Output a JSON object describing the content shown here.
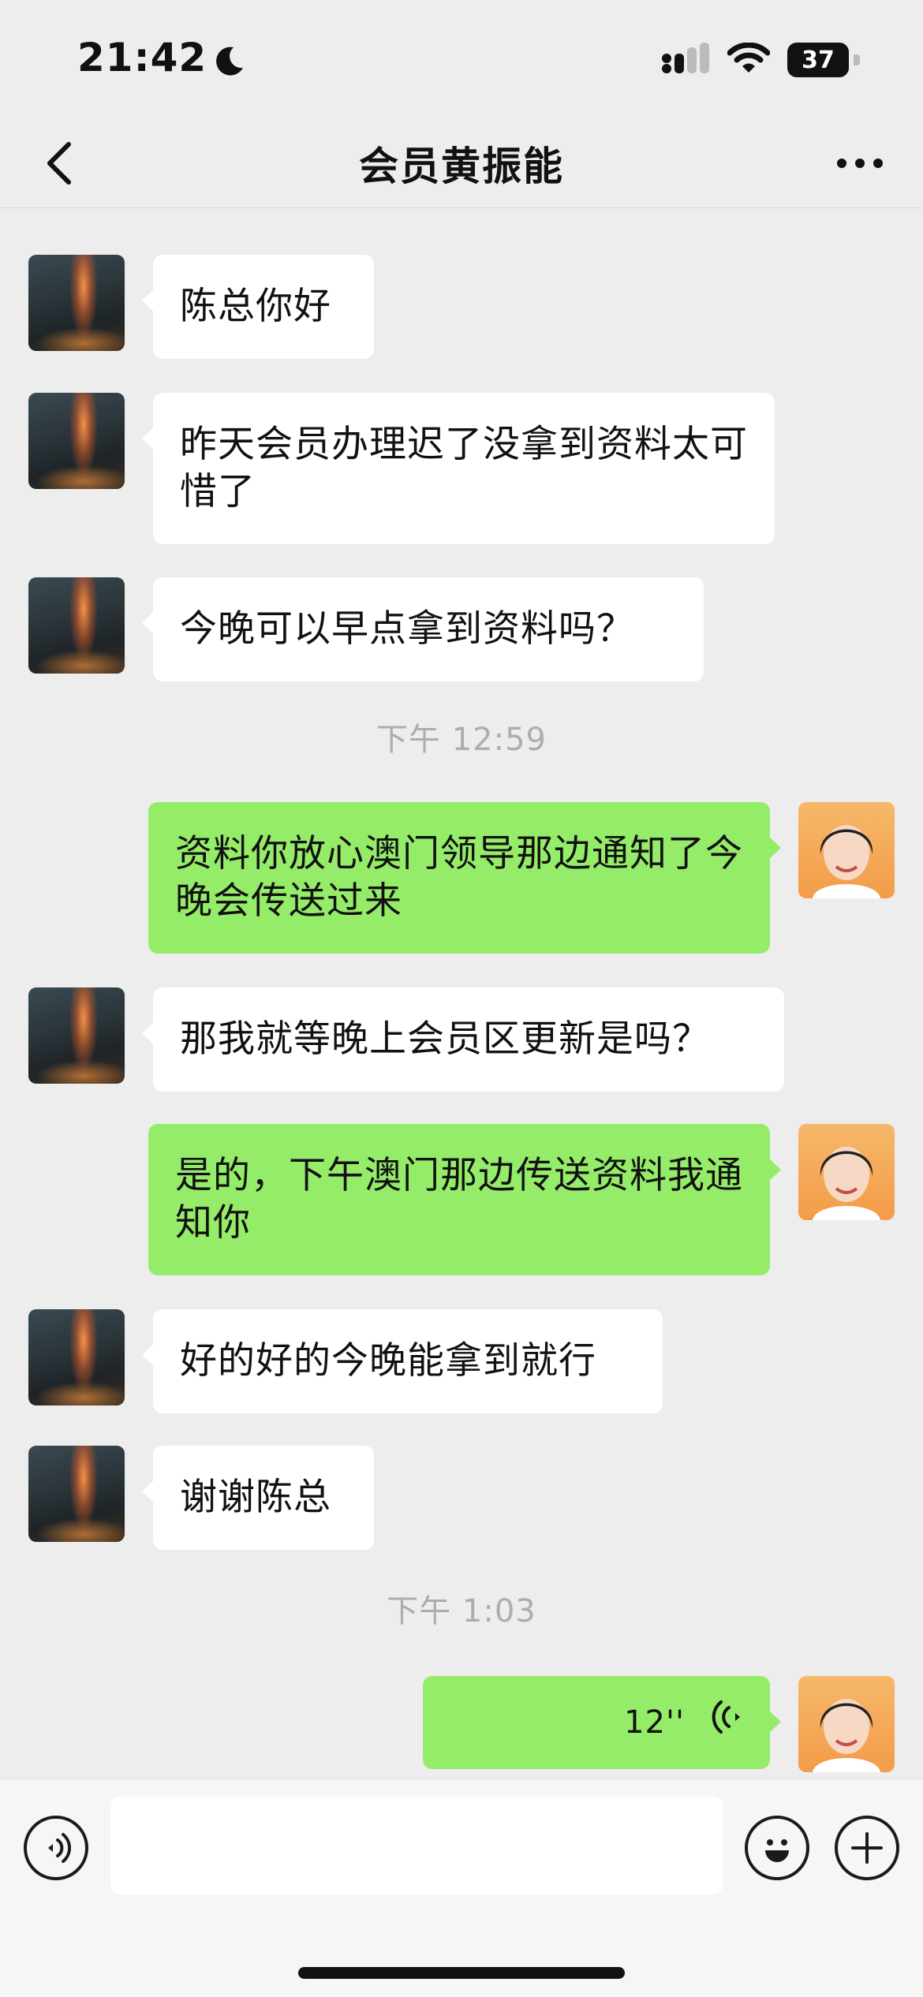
{
  "status_bar": {
    "time": "21:42",
    "battery": "37"
  },
  "header": {
    "title": "会员黄振能"
  },
  "messages": [
    {
      "type": "in",
      "text": "陈总你好"
    },
    {
      "type": "in",
      "text": "昨天会员办理迟了没拿到资料太可惜了"
    },
    {
      "type": "in",
      "text": "今晚可以早点拿到资料吗？"
    },
    {
      "type": "time",
      "text": "下午 12:59"
    },
    {
      "type": "out",
      "text": "资料你放心澳门领导那边通知了今晚会传送过来"
    },
    {
      "type": "in",
      "text": "那我就等晚上会员区更新是吗？"
    },
    {
      "type": "out",
      "text": "是的，下午澳门那边传送资料我通知你"
    },
    {
      "type": "in",
      "text": "好的好的今晚能拿到就行"
    },
    {
      "type": "in",
      "text": "谢谢陈总"
    },
    {
      "type": "time",
      "text": "下午 1:03"
    },
    {
      "type": "out-voice",
      "text": "12''"
    }
  ],
  "input": {
    "value": "",
    "placeholder": ""
  },
  "icons": {
    "back": "chevron-left-icon",
    "more": "more-dots-icon",
    "voice": "voice-icon",
    "emoji": "emoji-icon",
    "plus": "plus-icon"
  },
  "colors": {
    "background": "#EDEDED",
    "incoming_bubble": "#FFFFFF",
    "outgoing_bubble": "#95EC69",
    "timestamp": "#ADADAD"
  }
}
